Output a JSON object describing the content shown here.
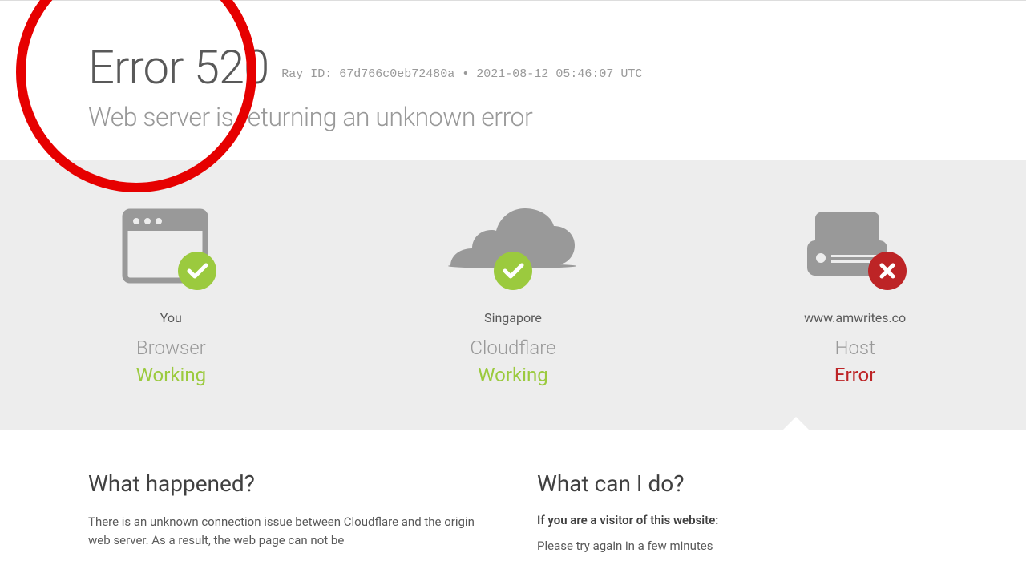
{
  "header": {
    "error_title": "Error 520",
    "ray_label": "Ray ID:",
    "ray_id": "67d766c0eb72480a",
    "separator": "•",
    "timestamp": "2021-08-12 05:46:07 UTC",
    "subtitle": "Web server is returning an unknown error"
  },
  "status": {
    "browser": {
      "you_label": "You",
      "type_label": "Browser",
      "status": "Working"
    },
    "cloudflare": {
      "location": "Singapore",
      "type_label": "Cloudflare",
      "status": "Working"
    },
    "host": {
      "domain": "www.amwrites.co",
      "type_label": "Host",
      "status": "Error"
    }
  },
  "info": {
    "what_happened": {
      "title": "What happened?",
      "body": "There is an unknown connection issue between Cloudflare and the origin web server. As a result, the web page can not be"
    },
    "what_can_i_do": {
      "title": "What can I do?",
      "visitor_heading": "If you are a visitor of this website:",
      "visitor_body": "Please try again in a few minutes"
    }
  }
}
